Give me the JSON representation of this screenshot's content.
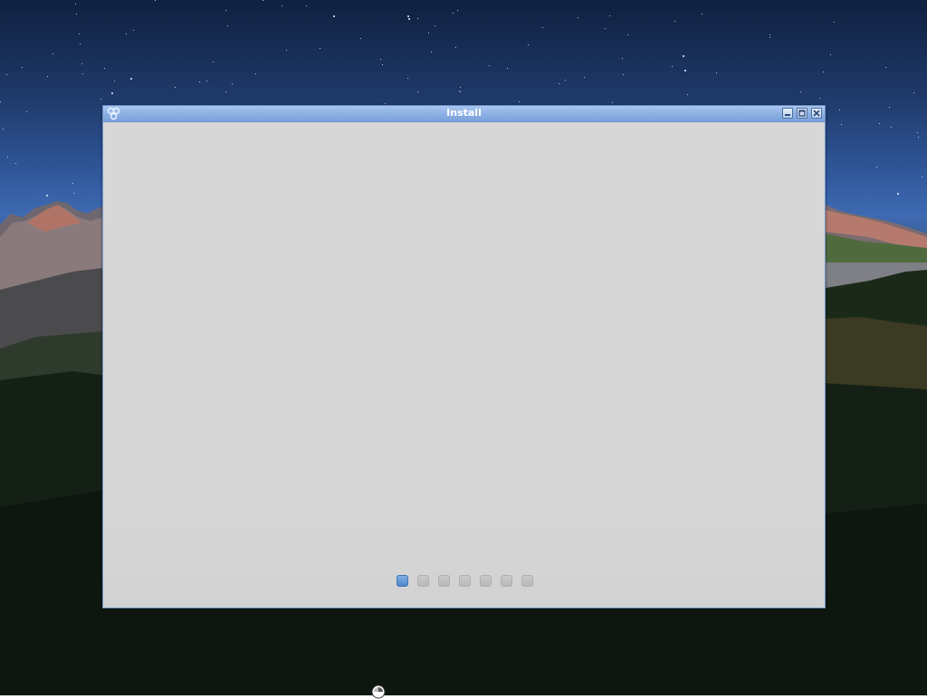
{
  "window": {
    "title": "Install",
    "app_icon": "installer-icon",
    "controls": {
      "minimize": "minimize-icon",
      "maximize": "maximize-icon",
      "close": "close-icon"
    }
  },
  "pager": {
    "total_pages": 7,
    "current_page": 1,
    "active_color": "#5b93d1",
    "inactive_color": "#c2c2c2"
  },
  "desktop": {
    "wallpaper": "night-sky-mountains",
    "cursor": "busy-cursor-icon"
  }
}
